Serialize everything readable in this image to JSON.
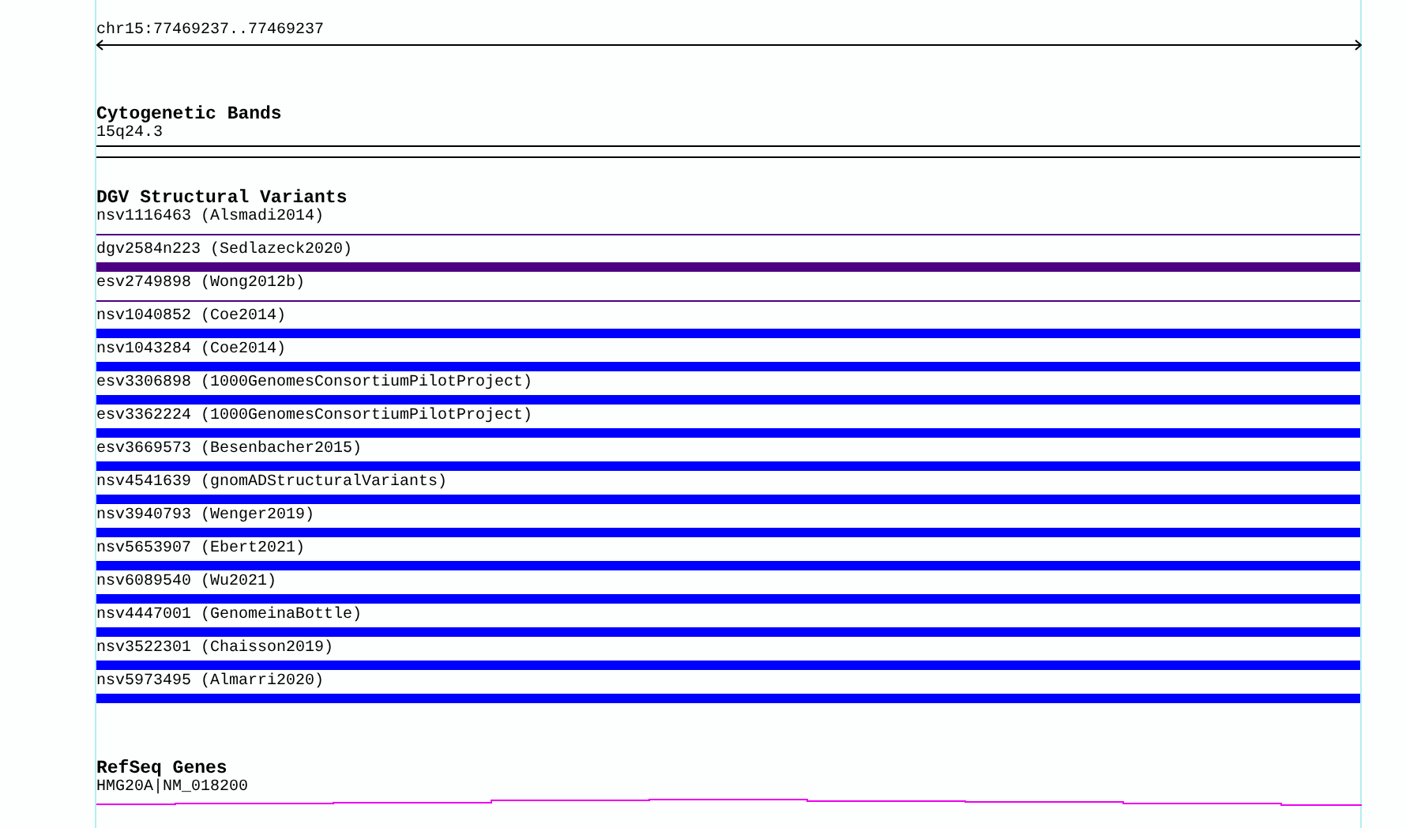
{
  "ruler": {
    "label": "chr15:77469237..77469237"
  },
  "tracks": [
    {
      "title": "Cytogenetic Bands",
      "kind": "bands",
      "features": [
        {
          "label": "15q24.3"
        }
      ]
    },
    {
      "title": "DGV Structural Variants",
      "kind": "variants",
      "features": [
        {
          "label": "nsv1116463 (Alsmadi2014)",
          "kind": "thin",
          "color": "#4b0082"
        },
        {
          "label": "dgv2584n223 (Sedlazeck2020)",
          "kind": "thick",
          "color": "#4b0082"
        },
        {
          "label": "esv2749898 (Wong2012b)",
          "kind": "thin",
          "color": "#4b0082"
        },
        {
          "label": "nsv1040852 (Coe2014)",
          "kind": "thick",
          "color": "#0000ff"
        },
        {
          "label": "nsv1043284 (Coe2014)",
          "kind": "thick",
          "color": "#0000ff"
        },
        {
          "label": "esv3306898 (1000GenomesConsortiumPilotProject)",
          "kind": "thick",
          "color": "#0000ff"
        },
        {
          "label": "esv3362224 (1000GenomesConsortiumPilotProject)",
          "kind": "thick",
          "color": "#0000ff"
        },
        {
          "label": "esv3669573 (Besenbacher2015)",
          "kind": "thick",
          "color": "#0000ff"
        },
        {
          "label": "nsv4541639 (gnomADStructuralVariants)",
          "kind": "thick",
          "color": "#0000ff"
        },
        {
          "label": "nsv3940793 (Wenger2019)",
          "kind": "thick",
          "color": "#0000ff"
        },
        {
          "label": "nsv5653907 (Ebert2021)",
          "kind": "thick",
          "color": "#0000ff"
        },
        {
          "label": "nsv6089540 (Wu2021)",
          "kind": "thick",
          "color": "#0000ff"
        },
        {
          "label": "nsv4447001 (GenomeinaBottle)",
          "kind": "thick",
          "color": "#0000ff"
        },
        {
          "label": "nsv3522301 (Chaisson2019)",
          "kind": "thick",
          "color": "#0000ff"
        },
        {
          "label": "nsv5973495 (Almarri2020)",
          "kind": "thick",
          "color": "#0000ff"
        }
      ]
    },
    {
      "title": "RefSeq Genes",
      "kind": "genes",
      "features": [
        {
          "label": "HMG20A|NM_018200"
        }
      ]
    }
  ]
}
